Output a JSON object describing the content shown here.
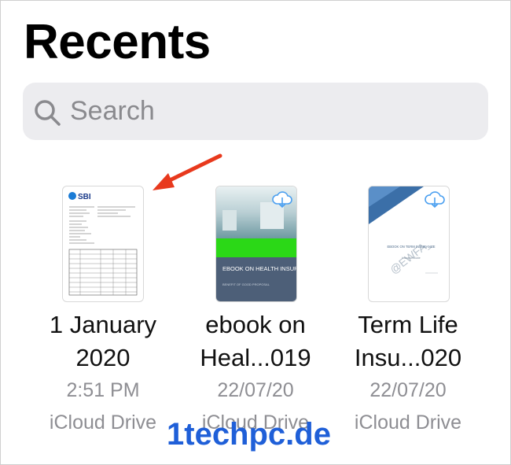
{
  "header": {
    "title": "Recents"
  },
  "search": {
    "placeholder": "Search"
  },
  "files": [
    {
      "name_line1": "1 January",
      "name_line2": "2020",
      "time": "2:51 PM",
      "location": "iCloud Drive",
      "thumb_logo": "SBI"
    },
    {
      "name_line1": "ebook on",
      "name_line2": "Heal...019",
      "date": "22/07/20",
      "location": "iCloud Drive",
      "cover_title": "EBOOK ON HEALTH INSURANCE",
      "cover_subtitle": "BENEFIT OF GOOD PROPOSAL"
    },
    {
      "name_line1": "Term Life",
      "name_line2": "Insu...020",
      "date": "22/07/20",
      "location": "iCloud Drive",
      "cover_title": "EBOOK ON TERM INSURANCE",
      "cover_subtitle": "Insurance Guide",
      "cover_mark": "@EWFA_"
    }
  ],
  "watermark": "1techpc.de",
  "colors": {
    "arrow": "#e8391d",
    "watermark": "#1f5fd8",
    "cloud": "#4a9ff0",
    "health_green": "#2bd817",
    "health_slate": "#4d5f78"
  }
}
